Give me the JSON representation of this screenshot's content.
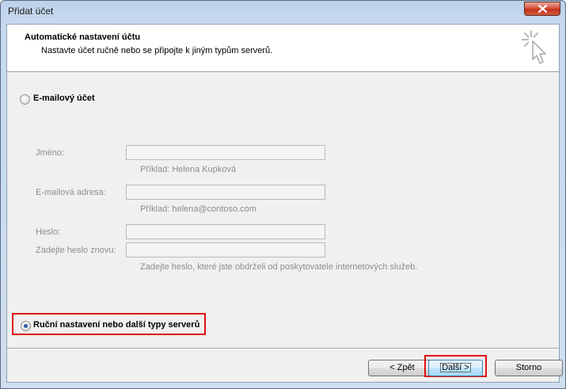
{
  "window": {
    "title": "Přidat účet",
    "close_icon": "close-icon"
  },
  "header": {
    "title": "Automatické nastavení účtu",
    "subtitle": "Nastavte účet ručně nebo se připojte k jiným typům serverů.",
    "icon": "cursor-click-icon"
  },
  "email_account": {
    "label": "E-mailový účet",
    "selected": false,
    "name_label": "Jméno:",
    "name_value": "",
    "name_hint": "Příklad: Helena Kupková",
    "email_label": "E-mailová adresa:",
    "email_value": "",
    "email_hint": "Příklad: helena@contoso.com",
    "password_label": "Heslo:",
    "password_value": "",
    "password_repeat_label": "Zadejte heslo znovu:",
    "password_repeat_value": "",
    "password_hint": "Zadejte heslo, které jste obdrželi od poskytovatele internetových služeb."
  },
  "manual_setup": {
    "label": "Ruční nastavení nebo další typy serverů",
    "selected": true
  },
  "buttons": {
    "back": "< Zpět",
    "next": "Další >",
    "cancel": "Storno"
  },
  "colors": {
    "highlight": "#e01010",
    "radio_dot": "#2a5aa8"
  }
}
